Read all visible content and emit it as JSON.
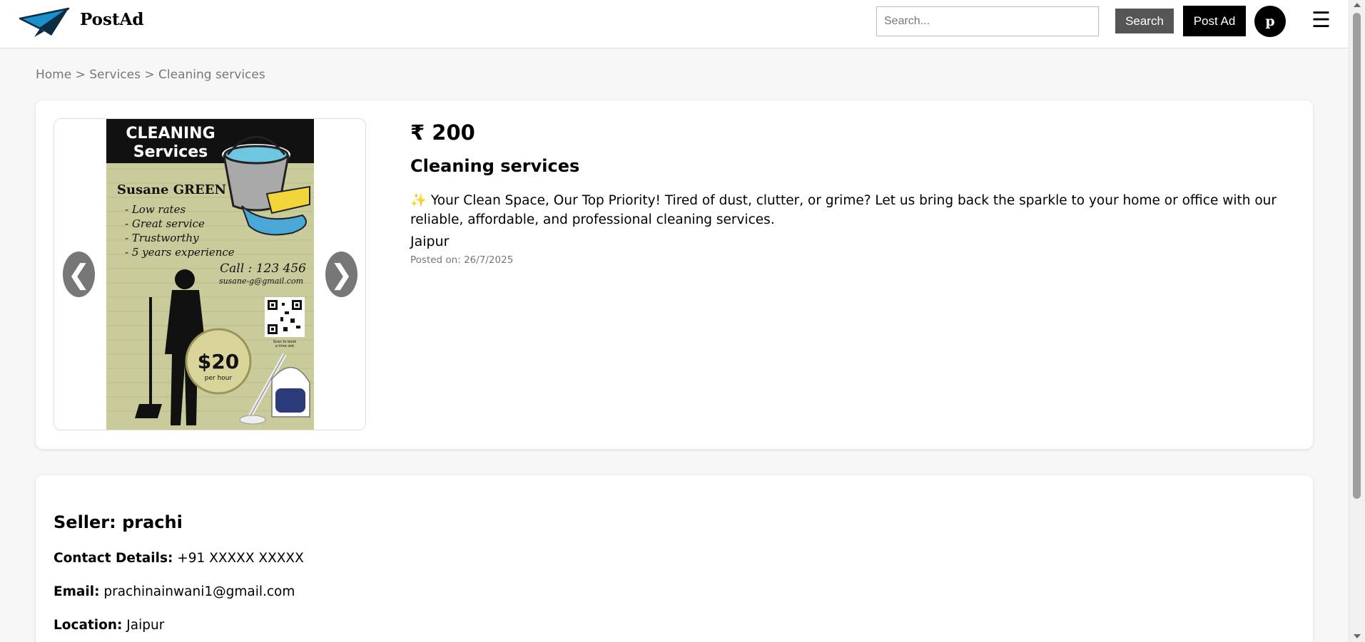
{
  "header": {
    "brand": "PostAd",
    "search_placeholder": "Search...",
    "search_button": "Search",
    "post_button": "Post Ad",
    "avatar_initial": "p",
    "menu_icon": "hamburger-icon",
    "logo_icon": "paper-plane-icon"
  },
  "breadcrumb": {
    "items": [
      "Home",
      "Services",
      "Cleaning services"
    ],
    "separator": ">"
  },
  "listing": {
    "price": "₹ 200",
    "title": "Cleaning services",
    "description": "✨ Your Clean Space, Our Top Priority! Tired of dust, clutter, or grime? Let us bring back the sparkle to your home or office with our reliable, affordable, and professional cleaning services.",
    "location": "Jaipur",
    "posted": "Posted on: 26/7/2025",
    "prev_arrow": "❮",
    "next_arrow": "❯"
  },
  "flyer": {
    "heading_1": "CLEANING",
    "heading_2": "Services",
    "name": "Susane GREEN",
    "bullets": [
      "- Low rates",
      "- Great service",
      "- Trustworthy",
      "- 5 years experience"
    ],
    "call": "Call : 123 456",
    "email": "susane-g@gmail.com",
    "price": "$20",
    "per": "per hour",
    "scan_1": "Scan to book",
    "scan_2": "a time slot"
  },
  "seller": {
    "name": "Seller: prachi",
    "contact_label": "Contact Details:",
    "contact_value": " +91 XXXXX XXXXX",
    "email_label": "Email:",
    "email_value": " prachinainwani1@gmail.com",
    "location_label": "Location:",
    "location_value": " Jaipur"
  },
  "colors": {
    "flyer_background": "#c9cc9a",
    "flyer_header": "#111111",
    "button_dark": "#000000",
    "button_gray": "#555555",
    "arrow": "#777777"
  }
}
